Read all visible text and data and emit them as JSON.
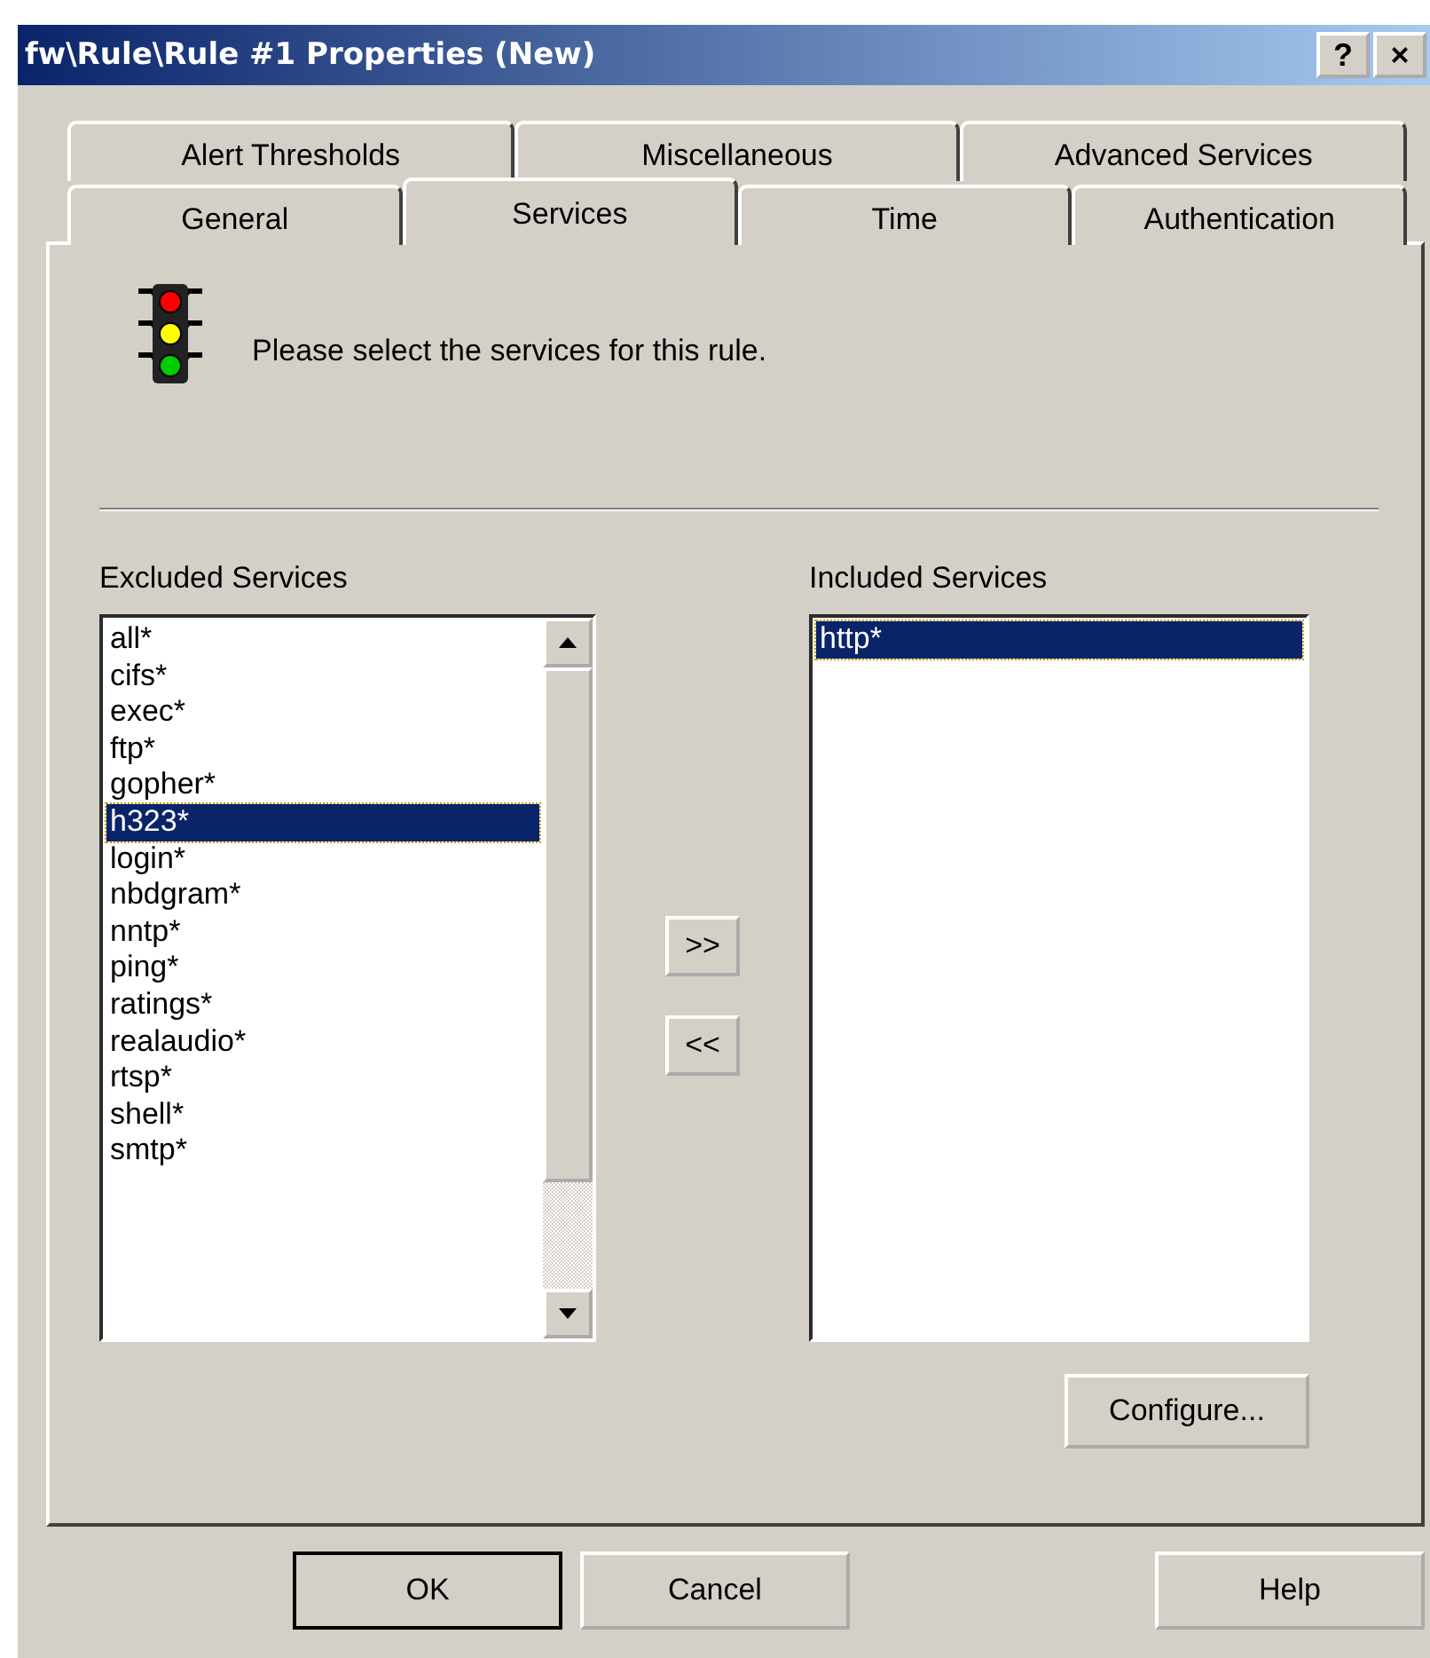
{
  "window": {
    "title": "fw\\Rule\\Rule #1 Properties (New)",
    "title_buttons": [
      "?",
      "×"
    ]
  },
  "tab_rows": [
    [
      {
        "label": "Alert Thresholds",
        "selected": false
      },
      {
        "label": "Miscellaneous",
        "selected": false
      },
      {
        "label": "Advanced Services",
        "selected": false
      }
    ],
    [
      {
        "label": "General",
        "selected": false
      },
      {
        "label": "Services",
        "selected": true
      },
      {
        "label": "Time",
        "selected": false
      },
      {
        "label": "Authentication",
        "selected": false
      }
    ]
  ],
  "intro": "Please select the services for this rule.",
  "excluded": {
    "label": "Excluded Services",
    "items": [
      {
        "label": "all*",
        "selected": false
      },
      {
        "label": "cifs*",
        "selected": false
      },
      {
        "label": "exec*",
        "selected": false
      },
      {
        "label": "ftp*",
        "selected": false
      },
      {
        "label": "gopher*",
        "selected": false
      },
      {
        "label": "h323*",
        "selected": true
      },
      {
        "label": "login*",
        "selected": false
      },
      {
        "label": "nbdgram*",
        "selected": false
      },
      {
        "label": "nntp*",
        "selected": false
      },
      {
        "label": "ping*",
        "selected": false
      },
      {
        "label": "ratings*",
        "selected": false
      },
      {
        "label": "realaudio*",
        "selected": false
      },
      {
        "label": "rtsp*",
        "selected": false
      },
      {
        "label": "shell*",
        "selected": false
      },
      {
        "label": "smtp*",
        "selected": false
      }
    ]
  },
  "move_buttons": [
    ">>",
    "<<"
  ],
  "included": {
    "label": "Included Services",
    "items": [
      {
        "label": "http*",
        "selected": true
      }
    ]
  },
  "configure_button": "Configure...",
  "buttons": [
    {
      "label": "OK",
      "default": true
    },
    {
      "label": "Cancel",
      "default": false
    },
    {
      "label": "Help",
      "default": false
    }
  ]
}
